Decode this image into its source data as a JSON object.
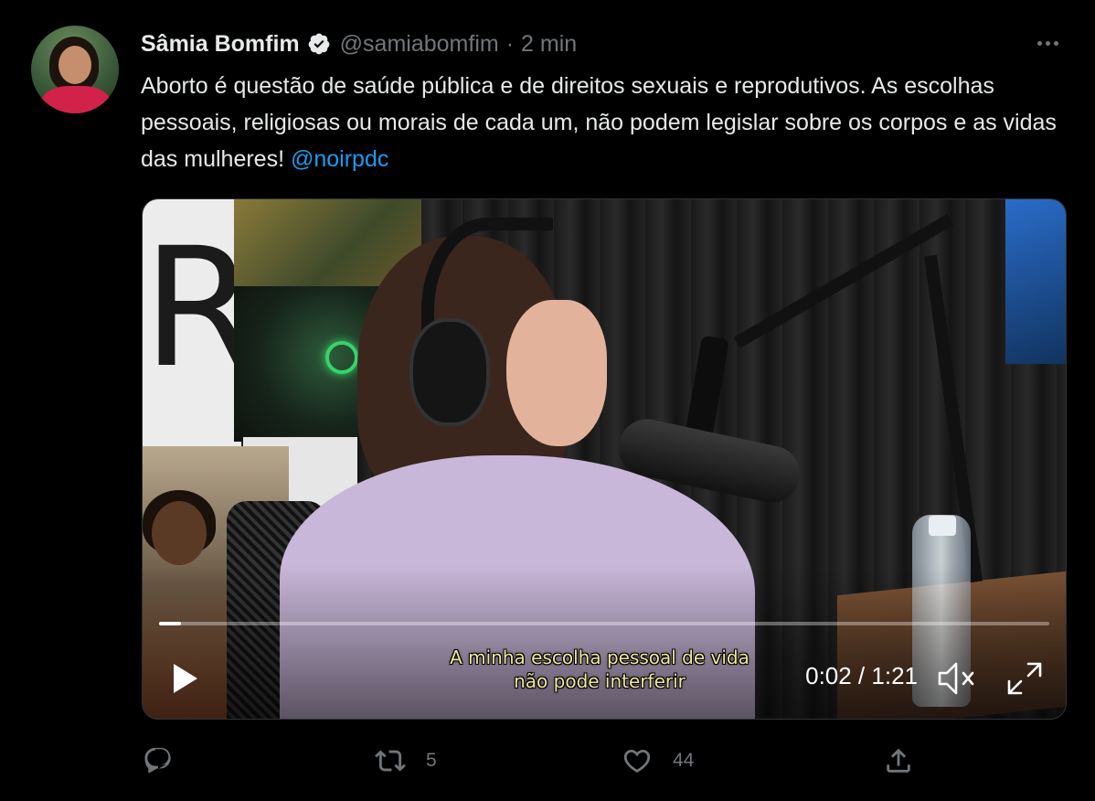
{
  "author": {
    "display_name": "Sâmia Bomfim",
    "handle": "@samiabomfim",
    "separator": "·",
    "timestamp": "2 min",
    "verified": true
  },
  "tweet": {
    "text": "Aborto é questão de saúde pública e de direitos sexuais e reprodutivos. As escolhas pessoais, religiosas ou morais de cada um, não podem legislar sobre os corpos e as vidas das mulheres! ",
    "mention": "@noirpdc"
  },
  "video": {
    "subtitle_line1": "A minha escolha pessoal de vida",
    "subtitle_line2": "não pode interferir",
    "timecode": "0:02 / 1:21",
    "progress_fraction": 0.025,
    "muted": true
  },
  "actions": {
    "reply": {
      "icon": "reply-icon",
      "count": ""
    },
    "retweet": {
      "icon": "retweet-icon",
      "count": "5"
    },
    "like": {
      "icon": "heart-icon",
      "count": "44"
    },
    "share": {
      "icon": "share-icon"
    }
  },
  "colors": {
    "background": "#000000",
    "text": "#e7e9ea",
    "secondary": "#71767b",
    "link": "#1d9bf0",
    "subtitle": "#f1e6a0"
  }
}
